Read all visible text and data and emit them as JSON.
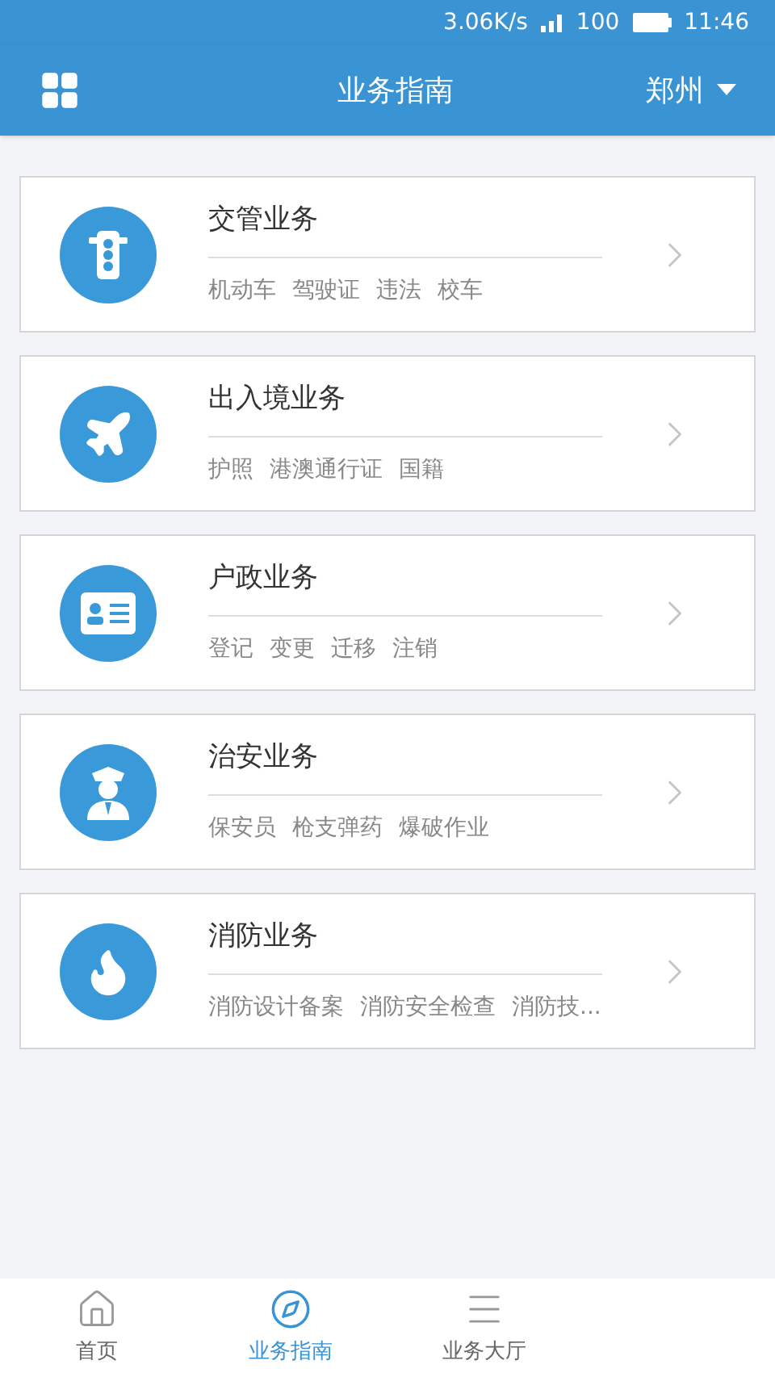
{
  "status_bar": {
    "speed": "3.06K/s",
    "battery": "100",
    "time": "11:46"
  },
  "header": {
    "title": "业务指南",
    "city": "郑州"
  },
  "services": [
    {
      "kind": "traffic",
      "title": "交管业务",
      "items": [
        "机动车",
        "驾驶证",
        "违法",
        "校车"
      ]
    },
    {
      "kind": "plane",
      "title": "出入境业务",
      "items": [
        "护照",
        "港澳通行证",
        "国籍"
      ]
    },
    {
      "kind": "card",
      "title": "户政业务",
      "items": [
        "登记",
        "变更",
        "迁移",
        "注销"
      ]
    },
    {
      "kind": "police",
      "title": "治安业务",
      "items": [
        "保安员",
        "枪支弹药",
        "爆破作业"
      ]
    },
    {
      "kind": "fire",
      "title": "消防业务",
      "items": [
        "消防设计备案",
        "消防安全检查",
        "消防技..."
      ]
    }
  ],
  "tabs": [
    {
      "kind": "home",
      "label": "首页",
      "selected": false
    },
    {
      "kind": "compass",
      "label": "业务指南",
      "selected": true
    },
    {
      "kind": "list",
      "label": "业务大厅",
      "selected": false
    }
  ]
}
